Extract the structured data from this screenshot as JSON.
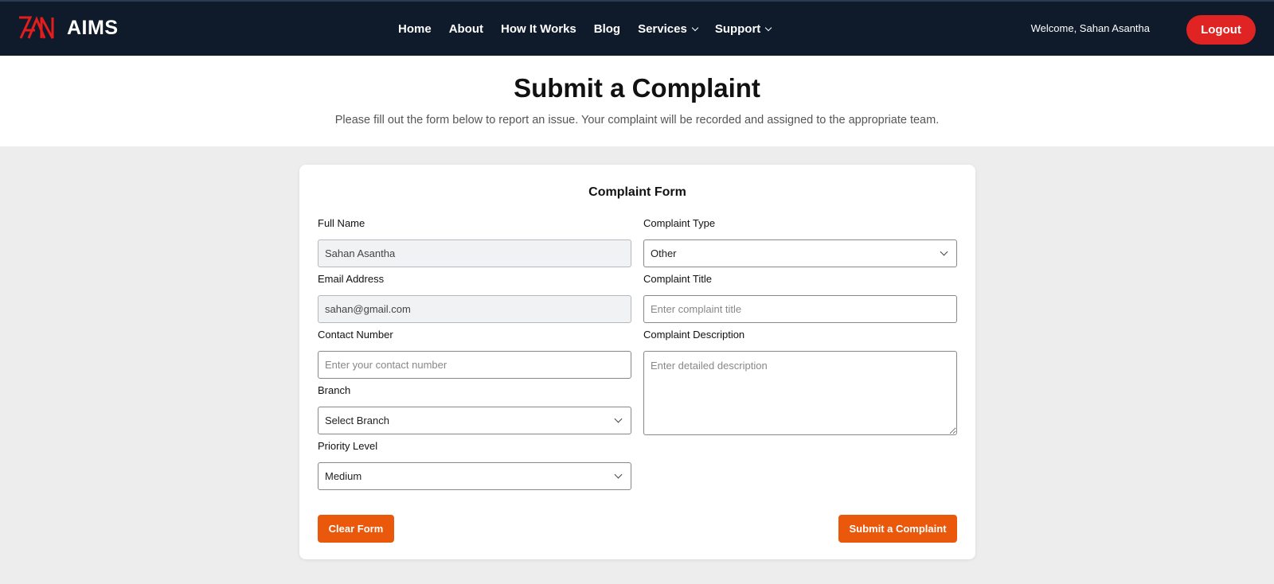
{
  "header": {
    "brand_name": "AIMS",
    "nav": [
      {
        "label": "Home"
      },
      {
        "label": "About"
      },
      {
        "label": "How It Works"
      },
      {
        "label": "Blog"
      },
      {
        "label": "Services"
      },
      {
        "label": "Support"
      }
    ],
    "welcome_text": "Welcome, Sahan Asantha",
    "logout_label": "Logout"
  },
  "hero": {
    "title": "Submit a Complaint",
    "subtitle": "Please fill out the form below to report an issue. Your complaint will be recorded and assigned to the appropriate team."
  },
  "form": {
    "title": "Complaint Form",
    "full_name": {
      "label": "Full Name",
      "value": "Sahan Asantha"
    },
    "email": {
      "label": "Email Address",
      "value": "sahan@gmail.com"
    },
    "contact": {
      "label": "Contact Number",
      "placeholder": "Enter your contact number"
    },
    "branch": {
      "label": "Branch",
      "selected": "Select Branch"
    },
    "priority": {
      "label": "Priority Level",
      "selected": "Medium"
    },
    "complaint_type": {
      "label": "Complaint Type",
      "selected": "Other"
    },
    "complaint_title": {
      "label": "Complaint Title",
      "placeholder": "Enter complaint title"
    },
    "description": {
      "label": "Complaint Description",
      "placeholder": "Enter detailed description"
    },
    "clear_label": "Clear Form",
    "submit_label": "Submit a Complaint"
  },
  "colors": {
    "navbar_bg": "#0f1a2b",
    "logout": "#e02424",
    "accent_orange": "#ea580c",
    "logo_red": "#e11d1d"
  }
}
